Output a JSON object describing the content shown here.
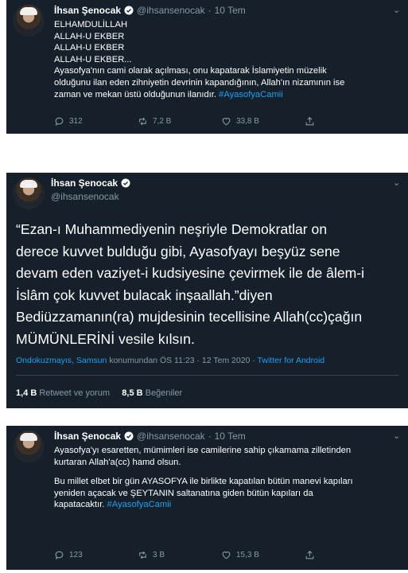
{
  "tweet1": {
    "name": "İhsan Şenocak",
    "handle": "@ihsansenocak",
    "separator": "·",
    "date": "10 Tem",
    "lines": [
      "ELHAMDULİLLAH",
      "ALLAH-U EKBER",
      "ALLAH-U EKBER",
      "ALLAH-U EKBER...",
      "Ayasofya'nın cami olarak açılması, onu kapatarak İslamiyetin müzelik",
      "olduğunu ilan eden zihniyetin devrinin kapandığının, Allah'ın nizamının ise"
    ],
    "last_line": "zaman ve mekan üstü olduğunun ilanıdır.",
    "hashtag": "#AyasofyaCamii",
    "replies": "312",
    "retweets": "7,2 B",
    "likes": "33,8 B"
  },
  "tweet2": {
    "name": "İhsan Şenocak",
    "handle": "@ihsansenocak",
    "lines": [
      "“Ezan-ı Muhammediyenin neşriyle Demokratlar on",
      "derece kuvvet bulduğu gibi, Ayasofyayı beşyüz sene",
      "devam eden vaziyet-i kudsiyesine çevirmek ile de âlem-i",
      "İslâm çok kuvvet  bulacak inşaallah.”diyen",
      "Bediüzzamanın(ra) mujdesinin tecellisine Allah(cc)çağın",
      "MÜMÜNLERİNİ vesile kılsın."
    ],
    "location": "Ondokuzmayıs, Samsun",
    "location_suffix": "konumundan ÖS 11:23 · 12 Tem 2020 ·",
    "source": "Twitter for Android",
    "retweet_count": "1,4 B",
    "retweet_label": "Retweet ve yorum",
    "like_count": "8,5 B",
    "like_label": "Beğeniler"
  },
  "tweet3": {
    "name": "İhsan Şenocak",
    "handle": "@ihsansenocak",
    "separator": "·",
    "date": "10 Tem",
    "lines": [
      "Ayasofya'yı esaretten, mümimleri ise camilerine sahip çıkamama zilletinden",
      "kurtaran Allah'a(cc) hamd olsun.",
      "",
      "Bu millet elbet bir gün AYASOFYA ile birlikte kapatılan bütün manevi kapıları",
      "yeniden açacak ve ŞEYTANIN saltanatına giden bütün kapıları da"
    ],
    "last_line": "kapatacaktır.",
    "hashtag": "#AyasofyaCamii",
    "replies": "123",
    "retweets": "3 B",
    "likes": "15,3 B"
  },
  "icons": {
    "reply": "reply-icon",
    "retweet": "retweet-icon",
    "like": "heart-icon",
    "share": "share-icon",
    "verified": "verified-badge-icon",
    "more": "chevron-down-icon"
  },
  "colors": {
    "background": "#15202b",
    "accent": "#1da1f2",
    "muted": "#8899a6",
    "text": "#ffffff"
  }
}
